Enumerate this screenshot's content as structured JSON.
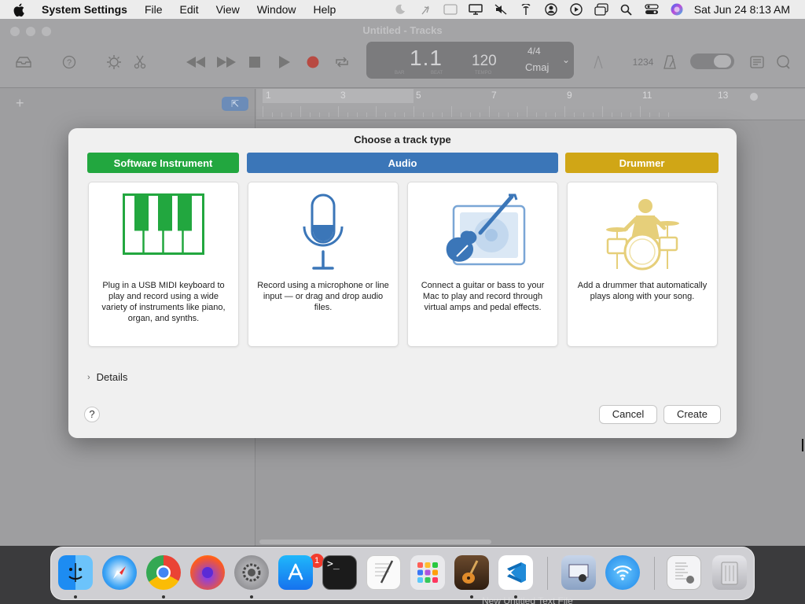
{
  "menubar": {
    "apple_icon": "apple-logo-icon",
    "app_name": "System Settings",
    "menus": [
      "File",
      "Edit",
      "View",
      "Window",
      "Help"
    ],
    "status_icons": [
      "moon-icon",
      "feather-icon",
      "window-frame-icon",
      "display-icon",
      "mute-icon",
      "antenna-icon",
      "user-circle-icon",
      "play-circle-icon",
      "windows-icon",
      "search-icon",
      "control-center-icon",
      "siri-icon"
    ],
    "clock": "Sat Jun 24  8:13 AM"
  },
  "window": {
    "title": "Untitled - Tracks",
    "lcd": {
      "position": "1.1",
      "tempo": "120",
      "time_signature": "4/4",
      "key": "Cmaj",
      "position_label": "BAR",
      "beat_label": "BEAT",
      "tempo_label": "TEMPO"
    },
    "count_in": "1234",
    "ruler_numbers": [
      "1",
      "3",
      "5",
      "7",
      "9",
      "11",
      "13"
    ]
  },
  "sheet": {
    "title": "Choose a track type",
    "categories": [
      {
        "label": "Software Instrument",
        "color": "#22a73f"
      },
      {
        "label": "Audio",
        "color": "#3b76b8"
      },
      {
        "label": "Drummer",
        "color": "#d0a616"
      }
    ],
    "cards": [
      {
        "icon": "piano-keyboard-icon",
        "description": "Plug in a USB MIDI keyboard to play and record using a wide variety of instruments like piano, organ, and synths."
      },
      {
        "icon": "microphone-icon",
        "description": "Record using a microphone or line input — or drag and drop audio files."
      },
      {
        "icon": "guitar-amp-icon",
        "description": "Connect a guitar or bass to your Mac to play and record through virtual amps and pedal effects."
      },
      {
        "icon": "drummer-icon",
        "description": "Add a drummer that automatically plays along with your song."
      }
    ],
    "details_label": "Details",
    "help_label": "?",
    "cancel_label": "Cancel",
    "create_label": "Create"
  },
  "dock": {
    "apps": [
      "Finder",
      "Safari",
      "Chrome",
      "Firefox",
      "System Settings",
      "App Store",
      "Terminal",
      "TextEdit",
      "Launchpad",
      "GarageBand",
      "Visual Studio Code",
      "Preview",
      "Wireless Diagnostics",
      "Downloads",
      "Trash"
    ],
    "badge": "1"
  },
  "background_text": "New Untitled Text File"
}
